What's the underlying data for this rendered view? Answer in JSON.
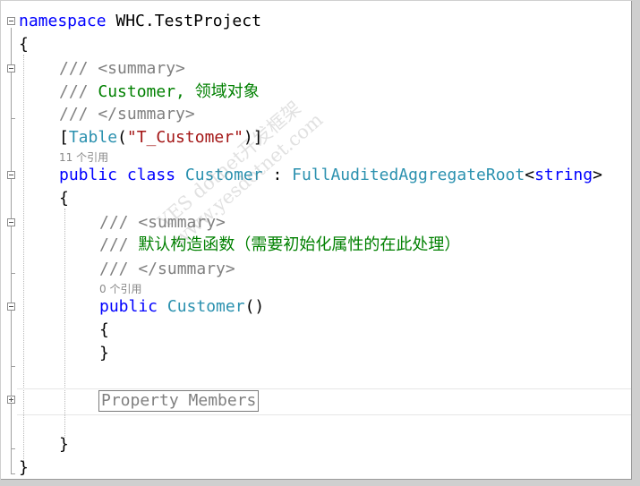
{
  "code": {
    "line1": {
      "kw": "namespace",
      "name": " WHC.TestProject"
    },
    "line2": "{",
    "line3": "/// <summary>",
    "line4": {
      "prefix": "/// ",
      "text": "Customer, 领域对象"
    },
    "line5": "/// </summary>",
    "line6": {
      "open": "[",
      "attr": "Table",
      "paren_open": "(",
      "str": "\"T_Customer\"",
      "close": ")]"
    },
    "lens1": "11 个引用",
    "line7": {
      "kw1": "public",
      "kw2": "class",
      "cls": "Customer",
      "colon": " : ",
      "base": "FullAuditedAggregateRoot",
      "lt": "<",
      "kw3": "string",
      "gt": ">"
    },
    "line8": "{",
    "line9": "/// <summary>",
    "line10": {
      "prefix": "/// ",
      "text": "默认构造函数（需要初始化属性的在此处理）"
    },
    "line11": "/// </summary>",
    "lens2": "0 个引用",
    "line12": {
      "kw": "public",
      "name": "Customer",
      "parens": "()"
    },
    "line13": "{",
    "line14": "}",
    "region": "Property Members",
    "line16": "}",
    "line17": "}"
  },
  "watermark": {
    "line1": "YES dotnet开发框架",
    "line2": "www.yesdotnet.com"
  },
  "colors": {
    "keyword": "#0000ff",
    "type": "#2b91af",
    "string": "#a31515",
    "comment": "#008000",
    "comment_tag": "#808080"
  }
}
